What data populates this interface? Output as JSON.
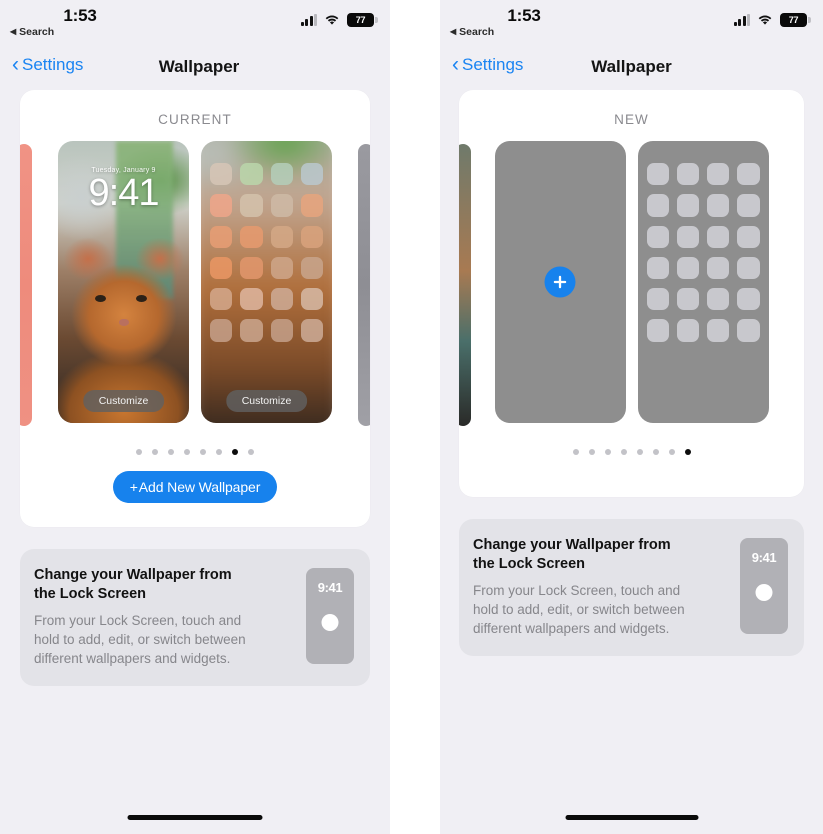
{
  "status_bar": {
    "time": "1:53",
    "back_label": "Search",
    "back_arrow": "◀",
    "battery_percent": "77",
    "icons": [
      "cellular-signal-icon",
      "wifi-icon",
      "battery-icon"
    ]
  },
  "nav": {
    "back_label": "Settings",
    "title": "Wallpaper"
  },
  "left_panel": {
    "section_label": "CURRENT",
    "lock_preview": {
      "date": "Tuesday, January 9",
      "time": "9:41",
      "customize_label": "Customize"
    },
    "home_preview": {
      "customize_label": "Customize"
    },
    "dots": {
      "count": 8,
      "active_index": 6
    },
    "add_button": {
      "plus": "+",
      "label": "Add New Wallpaper"
    }
  },
  "right_panel": {
    "section_label": "NEW",
    "add_wallpaper_icon": "plus-circle-icon",
    "dots": {
      "count": 8,
      "active_index": 7
    }
  },
  "info_card": {
    "title": "Change your Wallpaper from the Lock Screen",
    "body": "From your Lock Screen, touch and hold to add, edit, or switch between different wallpapers and widgets.",
    "preview_time": "9:41"
  },
  "colors": {
    "accent_blue": "#1782ed",
    "link_blue": "#1a84f2",
    "page_bg": "#f0eff4",
    "card_bg": "#ffffff",
    "info_card_bg": "#e3e3e8",
    "placeholder_gray": "#8e8e8e"
  }
}
